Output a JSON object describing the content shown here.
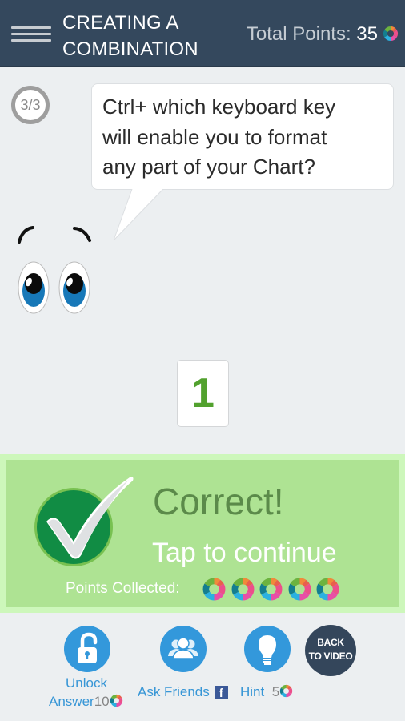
{
  "header": {
    "menu_icon": "hamburger-menu-icon",
    "title_line1": "CREATING A",
    "title_line2": "COMBINATION",
    "total_points_label": "Total Points: ",
    "total_points_value": "35",
    "points_icon": "points-swirl-logo-icon"
  },
  "question": {
    "progress": "3/3",
    "text_line1": "Ctrl+ which keyboard key",
    "text_line2": "will enable you to format",
    "text_line3": "any part of your Chart?",
    "mascot": "cartoon-eyes"
  },
  "answer": {
    "tiles": [
      "1"
    ]
  },
  "result": {
    "title": "Correct!",
    "subtitle": "Tap to continue",
    "points_collected_label": "Points Collected:",
    "points_collected_count": 5,
    "icon": "check-mark-icon"
  },
  "actions": {
    "unlock": {
      "label_line1": "Unlock",
      "label_line2": "Answer",
      "cost": "10",
      "icon": "unlock-padlock-icon"
    },
    "ask_friends": {
      "label": "Ask Friends",
      "icon": "friends-group-icon",
      "extra_icon": "facebook-icon",
      "fb_glyph": "f"
    },
    "hint": {
      "label": "Hint",
      "cost": "5",
      "icon": "lightbulb-icon"
    },
    "back_to_video": {
      "label_line1": "BACK",
      "label_line2": "TO VIDEO"
    }
  },
  "colors": {
    "header_bg": "#34485d",
    "page_bg": "#eceff1",
    "correct_bg": "#aee393",
    "correct_border": "#cdf7bb",
    "correct_title": "#5b8a4a",
    "action_blue": "#3398db",
    "back_video_bg": "#34465b",
    "answer_green": "#52a12e"
  }
}
